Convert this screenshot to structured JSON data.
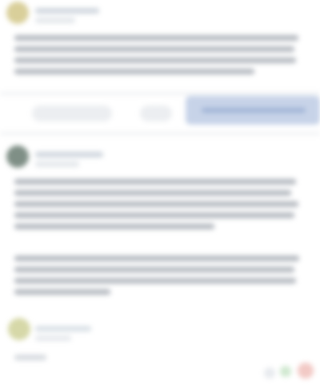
{
  "theme": {
    "avatar_1": "#d9cf9a",
    "avatar_2": "#7f8f86",
    "avatar_3": "#d6d8a8",
    "accent_blue": "#c7d3e8",
    "reaction_green": "#cfe8cf",
    "reaction_red": "#f2c9c5"
  },
  "posts": [
    {
      "avatar_icon": "user-avatar-icon"
    },
    {
      "avatar_icon": "user-avatar-icon"
    },
    {
      "avatar_icon": "user-avatar-icon"
    }
  ],
  "reactions": [
    {
      "icon": "reaction-icon"
    },
    {
      "icon": "reaction-icon"
    },
    {
      "icon": "reaction-icon"
    }
  ]
}
